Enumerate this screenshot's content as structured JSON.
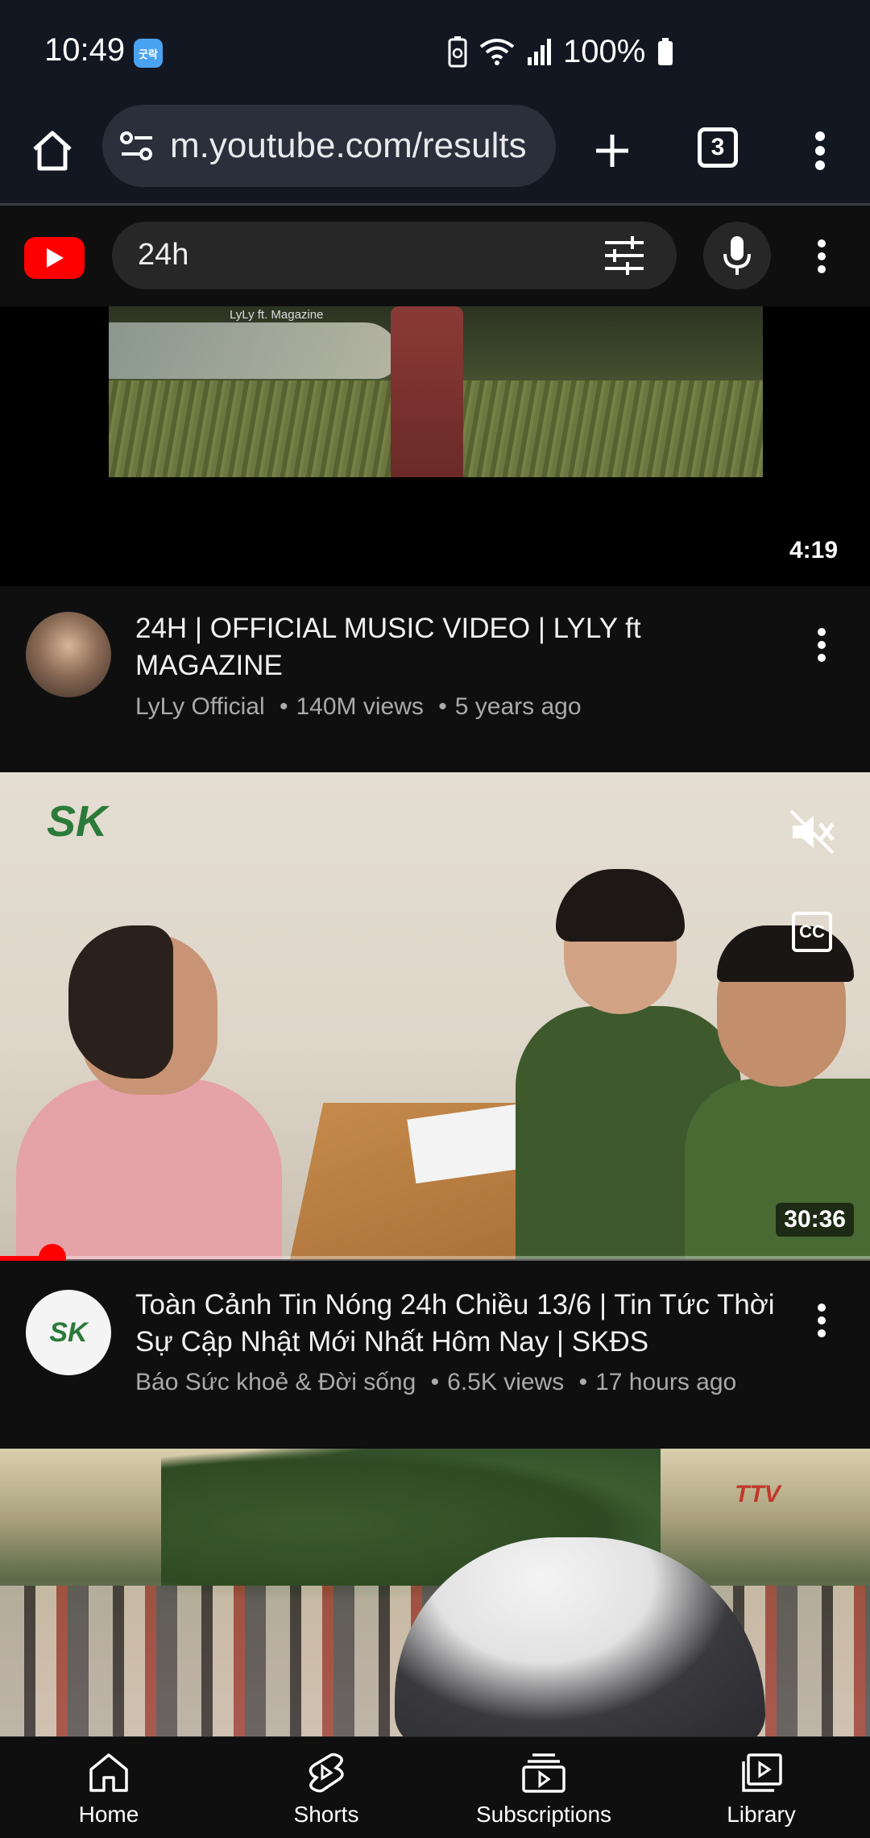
{
  "status_bar": {
    "time": "10:49",
    "badge": "굿락",
    "battery": "100%"
  },
  "browser": {
    "url": "m.youtube.com/results",
    "tab_count": "3"
  },
  "youtube": {
    "search_query": "24h"
  },
  "videos": [
    {
      "thumb_caption": "LyLy ft. Magazine",
      "duration": "4:19",
      "title": "24H | OFFICIAL MUSIC VIDEO | LYLY ft MAGAZINE",
      "channel": "LyLy Official",
      "views": "140M views",
      "age": "5 years ago"
    },
    {
      "logo": "SK",
      "duration": "30:36",
      "title": "Toàn Cảnh Tin Nóng 24h Chiều 13/6 | Tin Tức Thời Sự Cập Nhật Mới Nhất Hôm Nay | SKĐS",
      "channel": "Báo Sức khoẻ & Đời sống",
      "views": "6.5K views",
      "age": "17 hours ago",
      "progress": 0.06
    },
    {
      "logo": "TTV"
    }
  ],
  "bottom_nav": [
    {
      "label": "Home",
      "icon": "home-icon"
    },
    {
      "label": "Shorts",
      "icon": "shorts-icon"
    },
    {
      "label": "Subscriptions",
      "icon": "subscriptions-icon"
    },
    {
      "label": "Library",
      "icon": "library-icon"
    }
  ]
}
